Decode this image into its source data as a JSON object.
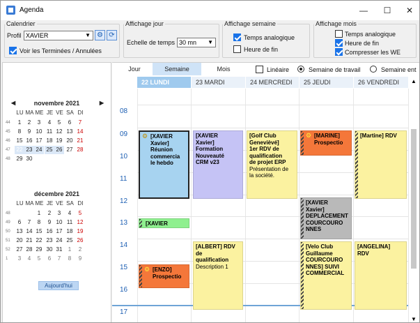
{
  "window": {
    "title": "Agenda",
    "minimize_glyph": "—",
    "maximize_glyph": "☐",
    "close_glyph": "✕"
  },
  "calendrier": {
    "legend": "Calendrier",
    "profil_label": "Profil",
    "profil_value": "XAVIER",
    "voir_label": "Voir les Terminées / Annulées",
    "voir_checked": true
  },
  "affichage_jour": {
    "legend": "Affichage jour",
    "echelle_label": "Echelle de temps",
    "echelle_value": "30 mn"
  },
  "affichage_semaine": {
    "legend": "Affichage semaine",
    "temps_analogique": "Temps analogique",
    "temps_analogique_checked": true,
    "heure_de_fin": "Heure de fin",
    "heure_de_fin_checked": false
  },
  "affichage_mois": {
    "legend": "Affichage mois",
    "temps_analogique": "Temps analogique",
    "temps_analogique_checked": false,
    "heure_de_fin": "Heure de fin",
    "heure_de_fin_checked": true,
    "compresser": "Compresser les WE",
    "compresser_checked": true
  },
  "mini_cal": {
    "day_names": [
      "LU",
      "MA",
      "ME",
      "JE",
      "VE",
      "SA",
      "DI"
    ],
    "november": {
      "title": "novembre 2021",
      "weeks": [
        {
          "wk": "44",
          "days": [
            "1",
            "2",
            "3",
            "4",
            "5",
            "6",
            "7"
          ]
        },
        {
          "wk": "45",
          "days": [
            "8",
            "9",
            "10",
            "11",
            "12",
            "13",
            "14"
          ]
        },
        {
          "wk": "46",
          "days": [
            "15",
            "16",
            "17",
            "18",
            "19",
            "20",
            "21"
          ]
        },
        {
          "wk": "47",
          "days": [
            "22",
            "23",
            "24",
            "25",
            "26",
            "27",
            "28"
          ]
        },
        {
          "wk": "48",
          "days": [
            "29",
            "30",
            "",
            "",
            "",
            "",
            ""
          ]
        }
      ]
    },
    "december": {
      "title": "décembre 2021",
      "weeks": [
        {
          "wk": "48",
          "days": [
            "",
            "",
            "1",
            "2",
            "3",
            "4",
            "5"
          ]
        },
        {
          "wk": "49",
          "days": [
            "6",
            "7",
            "8",
            "9",
            "10",
            "11",
            "12"
          ]
        },
        {
          "wk": "50",
          "days": [
            "13",
            "14",
            "15",
            "16",
            "17",
            "18",
            "19"
          ]
        },
        {
          "wk": "51",
          "days": [
            "20",
            "21",
            "22",
            "23",
            "24",
            "25",
            "26"
          ]
        },
        {
          "wk": "52",
          "days": [
            "27",
            "28",
            "29",
            "30",
            "31",
            "1",
            "2"
          ]
        },
        {
          "wk": "1",
          "days": [
            "3",
            "4",
            "5",
            "6",
            "7",
            "8",
            "9"
          ]
        }
      ]
    },
    "prev_glyph": "◀",
    "next_glyph": "▶",
    "today_label": "Aujourd'hui"
  },
  "view_tabs": {
    "jour": "Jour",
    "semaine": "Semaine",
    "mois": "Mois",
    "lineaire": "Linéaire",
    "lineaire_checked": false,
    "semaine_travail": "Semaine de travail",
    "semaine_entiere": "Semaine ent"
  },
  "days": [
    "22 LUNDI",
    "23 MARDI",
    "24 MERCREDI",
    "25 JEUDI",
    "26 VENDREDI"
  ],
  "hours": [
    "08",
    "09",
    "10",
    "11",
    "12",
    "13",
    "14",
    "15",
    "16",
    "17"
  ],
  "events": {
    "e1": {
      "l1": "[XAVIER",
      "l2": "Xavier]",
      "l3": "Réunion",
      "l4": "commercia",
      "l5": "le hebdo"
    },
    "e2": {
      "l1": "[XAVIER",
      "l2": "Xavier]",
      "l3": "Formation",
      "l4": "Nouveauté",
      "l5": "CRM v23"
    },
    "e3": {
      "l1": "[Golf Club",
      "l2": "Genevièvé]",
      "l3": "1er RDV de",
      "l4": "qualification",
      "l5": "de projet ERP",
      "l6": "Présentation de",
      "l7": "la société."
    },
    "e4": {
      "l1": "[MARINE]",
      "l2": "Prospectio"
    },
    "e5": {
      "l1": "[Martine] RDV"
    },
    "e6": {
      "l1": "[XAVIER"
    },
    "e7": {
      "l1": "[XAVIER",
      "l2": "Xavier]",
      "l3": "DEPLACEMENT",
      "l4": "COURCOURO",
      "l5": "NNES"
    },
    "e8": {
      "l1": "[ALBERT] RDV",
      "l2": "de",
      "l3": "qualification",
      "l4": "Description 1"
    },
    "e9": {
      "l1": "[Velo Club",
      "l2": "Guillaume",
      "l3": "COURCOURO",
      "l4": "NNES] SUIVI",
      "l5": "COMMERCIAL"
    },
    "e10": {
      "l1": "[ANGELINA]",
      "l2": "RDV"
    },
    "e11": {
      "l1": "[ENZO]",
      "l2": "Prospectio"
    }
  },
  "colors": {
    "blue_event": "#a7d3f0",
    "purple_event": "#c5c3f5",
    "yellow_event": "#fbf2a0",
    "orange_event": "#f4773a",
    "green_event": "#8ff08f",
    "gray_event": "#b9b9b9",
    "accent": "#1f6fd1"
  }
}
